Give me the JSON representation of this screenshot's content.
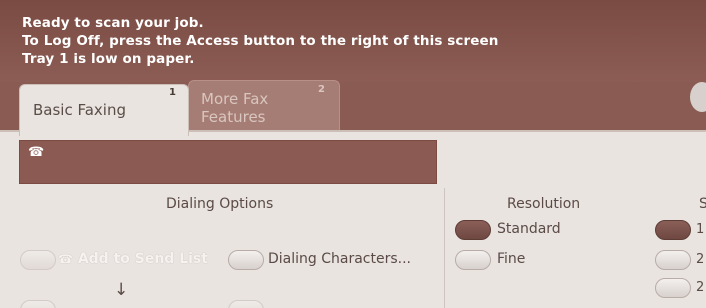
{
  "status": {
    "lines": [
      "Ready to scan your job.",
      "To Log Off, press the Access button to the right of this screen",
      "Tray 1 is low on paper."
    ]
  },
  "tabs": [
    {
      "label": "Basic Faxing",
      "number": "1",
      "active": true
    },
    {
      "label": "More Fax Features",
      "number": "2",
      "active": false
    }
  ],
  "number_bar": {
    "icon": "phone-icon"
  },
  "dialing_options": {
    "header": "Dialing Options",
    "add_to_send_list": "Add to Send List",
    "dialing_characters": "Dialing Characters..."
  },
  "resolution": {
    "header": "Resolution",
    "options": [
      "Standard",
      "Fine"
    ],
    "selected": "Standard"
  },
  "cut_off_section": {
    "header_fragment": "S",
    "items": [
      "1",
      "2",
      "2"
    ]
  },
  "colors": {
    "status_bg": "#8a5b52",
    "panel_bg": "#e9e4e0",
    "selected_button": "#6f4842"
  }
}
